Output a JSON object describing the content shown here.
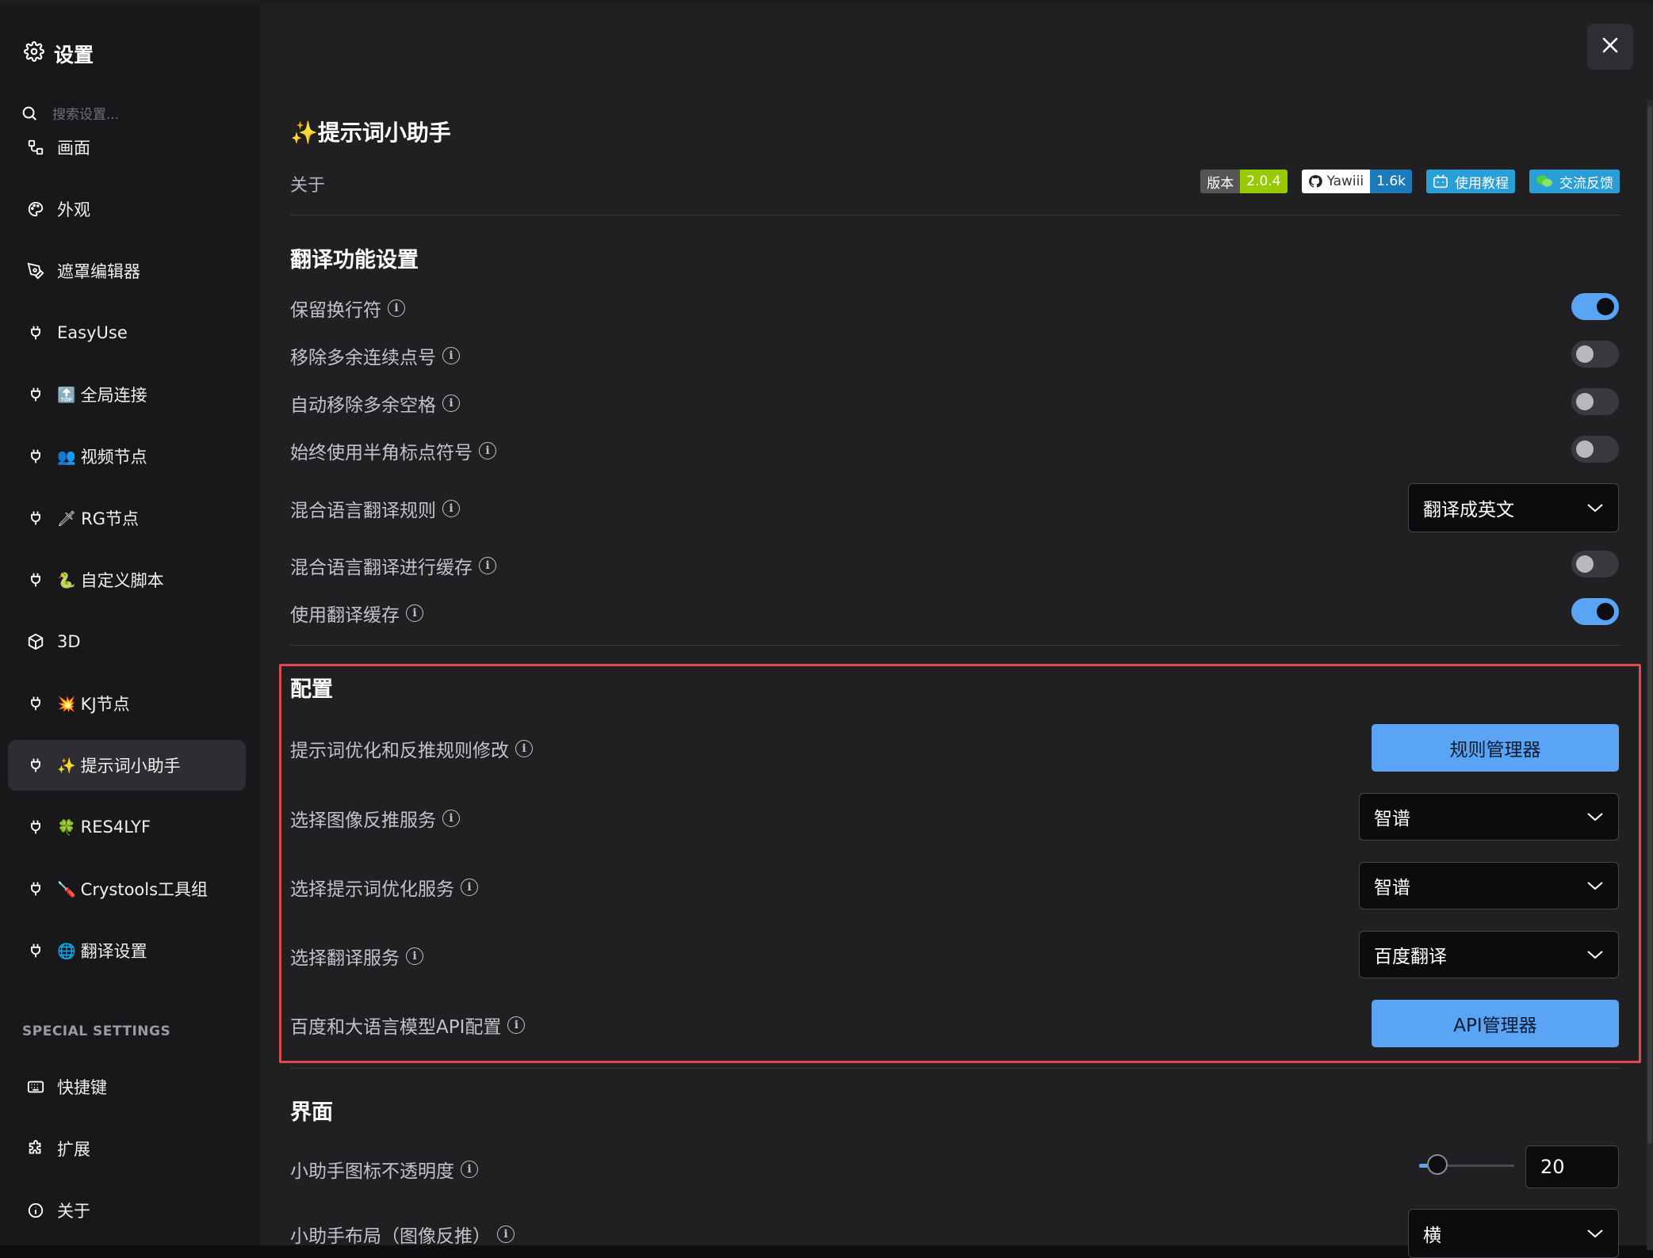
{
  "sidebar": {
    "title": "设置",
    "search_placeholder": "搜索设置...",
    "items": [
      {
        "label": "画面",
        "emoji": ""
      },
      {
        "label": "外观",
        "emoji": ""
      },
      {
        "label": "遮罩编辑器",
        "emoji": ""
      },
      {
        "label": "EasyUse",
        "emoji": ""
      },
      {
        "label": "全局连接",
        "emoji": "🔝"
      },
      {
        "label": "视频节点",
        "emoji": "👥"
      },
      {
        "label": "RG节点",
        "emoji": "🗡"
      },
      {
        "label": "自定义脚本",
        "emoji": "🐍"
      },
      {
        "label": "3D",
        "emoji": ""
      },
      {
        "label": "KJ节点",
        "emoji": "💥"
      },
      {
        "label": "提示词小助手",
        "emoji": "✨"
      },
      {
        "label": "RES4LYF",
        "emoji": "🍀"
      },
      {
        "label": "Crystools工具组",
        "emoji": "🪛"
      },
      {
        "label": "翻译设置",
        "emoji": "🌐"
      }
    ],
    "special_section": "SPECIAL SETTINGS",
    "special_items": [
      {
        "label": "快捷键"
      },
      {
        "label": "扩展"
      },
      {
        "label": "关于"
      }
    ]
  },
  "header": {
    "title": "✨提示词小助手",
    "about_label": "关于",
    "badges": [
      {
        "left": "版本",
        "right": "2.0.4",
        "left_color": "#555555",
        "right_color": "#97ca00"
      },
      {
        "left": "Yawiii",
        "right": "1.6k",
        "left_color": "#ffffff",
        "right_color": "#1d7ab8"
      },
      {
        "left": "使用教程",
        "right": "",
        "left_color": "#2a9fd6",
        "right_color": ""
      },
      {
        "left": "交流反馈",
        "right": "",
        "left_color": "#2a9fd6",
        "right_color": ""
      }
    ]
  },
  "translate_section": {
    "title": "翻译功能设置",
    "rows": [
      {
        "label": "保留换行符",
        "enabled": true
      },
      {
        "label": "移除多余连续点号",
        "enabled": false
      },
      {
        "label": "自动移除多余空格",
        "enabled": false
      },
      {
        "label": "始终使用半角标点符号",
        "enabled": false
      }
    ],
    "mixed_rule_label": "混合语言翻译规则",
    "mixed_rule_value": "翻译成英文",
    "mixed_cache_label": "混合语言翻译进行缓存",
    "mixed_cache_enabled": false,
    "use_cache_label": "使用翻译缓存",
    "use_cache_enabled": true
  },
  "config_section": {
    "title": "配置",
    "rules_label": "提示词优化和反推规则修改",
    "rules_button": "规则管理器",
    "image_service_label": "选择图像反推服务",
    "image_service_value": "智谱",
    "prompt_service_label": "选择提示词优化服务",
    "prompt_service_value": "智谱",
    "translate_service_label": "选择翻译服务",
    "translate_service_value": "百度翻译",
    "api_label": "百度和大语言模型API配置",
    "api_button": "API管理器"
  },
  "ui_section": {
    "title": "界面",
    "opacity_label": "小助手图标不透明度",
    "opacity_value": "20",
    "layout_label": "小助手布局（图像反推）",
    "layout_value": "横"
  },
  "colors": {
    "accent": "#5aa4f6",
    "highlight_border": "#e04a4f"
  }
}
